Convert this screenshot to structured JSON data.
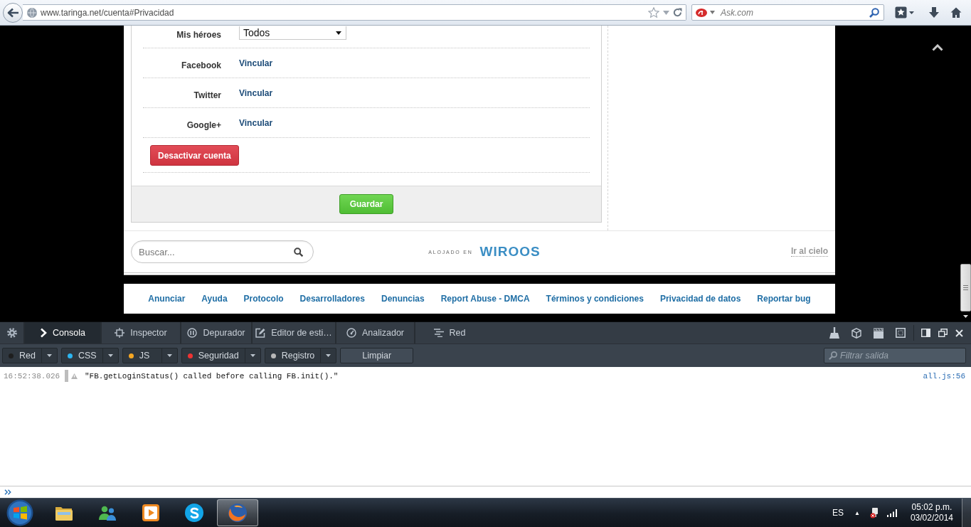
{
  "browser": {
    "url": "www.taringa.net/cuenta#Privacidad",
    "search": {
      "placeholder": "Ask.com"
    }
  },
  "form": {
    "rows": [
      {
        "kind": "select",
        "label": "Mis héroes",
        "value": "Todos"
      },
      {
        "kind": "link",
        "label": "Facebook",
        "value": "Vincular"
      },
      {
        "kind": "link",
        "label": "Twitter",
        "value": "Vincular"
      },
      {
        "kind": "link",
        "label": "Google+",
        "value": "Vincular"
      }
    ],
    "deactivate_button": "Desactivar cuenta",
    "save_button": "Guardar"
  },
  "site_footer": {
    "search": {
      "placeholder": "Buscar..."
    },
    "hosted_by": "ALOJADO EN",
    "host_logo": "WIROOS",
    "top_link": "Ir al cielo"
  },
  "footer_links": [
    "Anunciar",
    "Ayuda",
    "Protocolo",
    "Desarrolladores",
    "Denuncias",
    "Report Abuse - DMCA",
    "Términos y condiciones",
    "Privacidad de datos",
    "Reportar bug"
  ],
  "devtools": {
    "tabs": [
      {
        "label": "Consola",
        "selected": true
      },
      {
        "label": "Inspector",
        "selected": false
      },
      {
        "label": "Depurador",
        "selected": false
      },
      {
        "label": "Editor de esti…",
        "selected": false
      },
      {
        "label": "Analizador",
        "selected": false
      },
      {
        "label": "Red",
        "selected": false
      }
    ],
    "filters": [
      {
        "label": "Red",
        "color": "#1e1e1e"
      },
      {
        "label": "CSS",
        "color": "#2cb5f0"
      },
      {
        "label": "JS",
        "color": "#f5a623"
      },
      {
        "label": "Seguridad",
        "color": "#ee3333"
      },
      {
        "label": "Registro",
        "color": "#b8b8b8"
      }
    ],
    "clear_button": "Limpiar",
    "filter_field": {
      "placeholder": "Filtrar salida"
    },
    "messages": [
      {
        "kind": "warning",
        "time": "16:52:38.026",
        "text": "\"FB.getLoginStatus() called before calling FB.init().\"",
        "source": "all.js:56"
      }
    ]
  },
  "taskbar": {
    "apps": [
      {
        "kind": "folder",
        "selected": false
      },
      {
        "kind": "contacts",
        "selected": false
      },
      {
        "kind": "media",
        "selected": false
      },
      {
        "kind": "chat",
        "selected": false
      },
      {
        "kind": "browser",
        "selected": true
      }
    ],
    "language": "ES",
    "tray_toggle": "▲",
    "time": "05:02 p.m.",
    "date": "03/02/2014"
  }
}
